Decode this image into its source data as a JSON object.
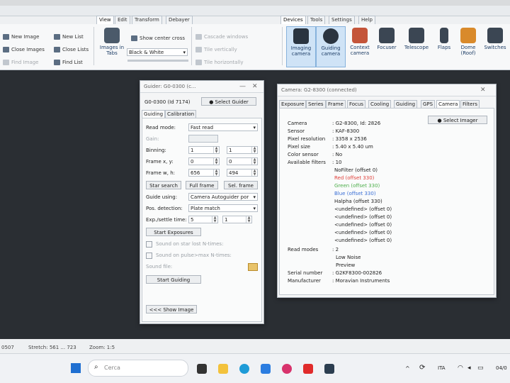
{
  "ribbon": {
    "tabs_left": [
      "View",
      "Edit",
      "Transform",
      "Debayer"
    ],
    "tabs_right": [
      "Devices",
      "Tools",
      "Settings",
      "Help"
    ],
    "group1": {
      "new_image": "New Image",
      "close_images": "Close Images",
      "find_image": "Find Image",
      "new_list": "New List",
      "close_lists": "Close Lists",
      "find_list": "Find List"
    },
    "images_in_tabs": "Images in Tabs",
    "stretch_mode": "Black & White",
    "show_center_cross": "Show center cross",
    "cascade_windows": "Cascade windows",
    "tile_vertically": "Tile vertically",
    "tile_horizontally": "Tile horizontally",
    "devices": [
      "Imaging camera",
      "Guiding camera",
      "Context camera",
      "Focuser",
      "Telescope",
      "Flaps",
      "Dome (Roof)",
      "Switches"
    ]
  },
  "guider": {
    "title": "Guider: G0-0300 (c...",
    "device_label": "G0-0300 (Id 7174)",
    "select_guider": "Select Guider",
    "tabs": [
      "Guiding",
      "Calibration"
    ],
    "read_mode_label": "Read mode:",
    "read_mode_value": "Fast read",
    "gain_label": "Gain:",
    "binning_label": "Binning:",
    "binning_x": "1",
    "binning_y": "1",
    "frame_xy_label": "Frame x, y:",
    "frame_x": "0",
    "frame_y": "0",
    "frame_wh_label": "Frame w, h:",
    "frame_w": "656",
    "frame_h": "494",
    "star_search": "Star search",
    "full_frame": "Full frame",
    "sel_frame": "Sel. frame",
    "guide_using_label": "Guide using:",
    "guide_using_value": "Camera Autoguider por",
    "pos_detection_label": "Pos. detection:",
    "pos_detection_value": "Plate match",
    "exp_settle_label": "Exp./settle time:",
    "exp_value": "5",
    "settle_value": "1",
    "start_exposures": "Start Exposures",
    "sound_star_lost": "Sound on star lost N-times:",
    "sound_pulse": "Sound on pulse>max N-times:",
    "sound_file_label": "Sound file:",
    "start_guiding": "Start Guiding",
    "show_image": "<<< Show Image"
  },
  "camera": {
    "title": "Camera: G2-8300 (connected)",
    "tabs": [
      "Exposure",
      "Series",
      "Frame",
      "Focus",
      "Cooling",
      "Guiding",
      "GPS",
      "Camera",
      "Filters"
    ],
    "select_imager": "Select Imager",
    "info": [
      {
        "k": "Camera",
        "v": ": G2-8300, Id: 2826"
      },
      {
        "k": "Sensor",
        "v": ": KAF-8300"
      },
      {
        "k": "Pixel resolution",
        "v": ": 3358 x 2536"
      },
      {
        "k": "Pixel size",
        "v": ": 5.40 x 5.40 um"
      },
      {
        "k": "Color sensor",
        "v": ": No"
      },
      {
        "k": "Available filters",
        "v": ": 10"
      }
    ],
    "filters": [
      {
        "name": "NoFilter (offset 0)",
        "color": "#222222"
      },
      {
        "name": "Red (offset 330)",
        "color": "#e0403a"
      },
      {
        "name": "Green (offset 330)",
        "color": "#4cae4a"
      },
      {
        "name": "Blue (offset 330)",
        "color": "#3a6fd6"
      },
      {
        "name": "Halpha (offset 330)",
        "color": "#222222"
      },
      {
        "name": "<undefined> (offset 0)",
        "color": "#222222"
      },
      {
        "name": "<undefined> (offset 0)",
        "color": "#222222"
      },
      {
        "name": "<undefined> (offset 0)",
        "color": "#222222"
      },
      {
        "name": "<undefined> (offset 0)",
        "color": "#222222"
      },
      {
        "name": "<undefined> (offset 0)",
        "color": "#222222"
      }
    ],
    "read_modes_label": "Read modes",
    "read_modes_count": ": 2",
    "read_modes": [
      "Low Noise",
      "Preview"
    ],
    "serial_label": "Serial number",
    "serial_value": ": G2KF8300-002826",
    "manufacturer_label": "Manufacturer",
    "manufacturer_value": ": Moravian Instruments"
  },
  "status": {
    "left": "0507",
    "stretch": "Stretch: 561 ... 723",
    "zoom": "Zoom: 1:5"
  },
  "taskbar": {
    "search_placeholder": "Cerca",
    "lang": "ITA",
    "time": "04/0"
  }
}
